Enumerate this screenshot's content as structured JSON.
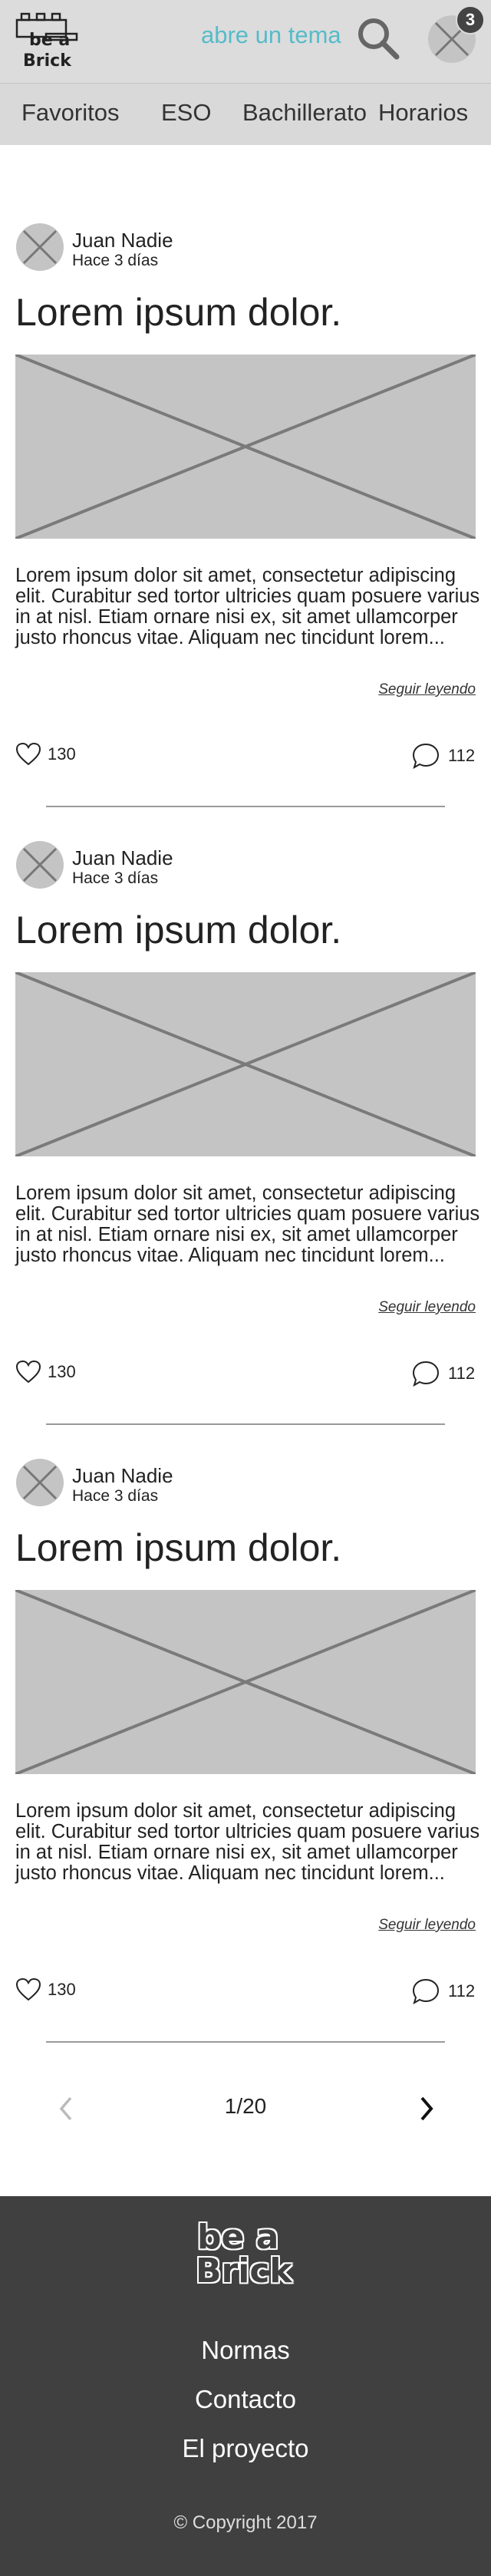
{
  "header": {
    "logo_line1": "be a",
    "logo_line2": "Brick",
    "search_placeholder": "abre un tema",
    "notification_count": "3"
  },
  "nav": {
    "items": [
      {
        "label": "Favoritos"
      },
      {
        "label": "ESO"
      },
      {
        "label": "Bachillerato"
      },
      {
        "label": "Horarios"
      }
    ]
  },
  "posts": [
    {
      "author": "Juan Nadie",
      "date": "Hace 3 días",
      "title": "Lorem ipsum dolor.",
      "excerpt": "Lorem ipsum dolor sit amet, consectetur adipiscing elit. Curabitur sed tortor ultricies quam posuere varius in at nisl. Etiam ornare nisi ex, sit amet ullamcorper justo rhoncus vitae. Aliquam nec tincidunt lorem...",
      "read_more": "Seguir leyendo",
      "likes": "130",
      "comments": "112"
    },
    {
      "author": "Juan Nadie",
      "date": "Hace 3 días",
      "title": "Lorem ipsum dolor.",
      "excerpt": "Lorem ipsum dolor sit amet, consectetur adipiscing elit. Curabitur sed tortor ultricies quam posuere varius in at nisl. Etiam ornare nisi ex, sit amet ullamcorper justo rhoncus vitae. Aliquam nec tincidunt lorem...",
      "read_more": "Seguir leyendo",
      "likes": "130",
      "comments": "112"
    },
    {
      "author": "Juan Nadie",
      "date": "Hace 3 días",
      "title": "Lorem ipsum dolor.",
      "excerpt": "Lorem ipsum dolor sit amet, consectetur adipiscing elit. Curabitur sed tortor ultricies quam posuere varius in at nisl. Etiam ornare nisi ex, sit amet ullamcorper justo rhoncus vitae. Aliquam nec tincidunt lorem...",
      "read_more": "Seguir leyendo",
      "likes": "130",
      "comments": "112"
    }
  ],
  "pagination": {
    "current": "1/20"
  },
  "footer": {
    "logo_line1": "be a",
    "logo_line2": "Brick",
    "links": [
      {
        "label": "Normas"
      },
      {
        "label": "Contacto"
      },
      {
        "label": "El proyecto"
      }
    ],
    "copyright": "© Copyright 2017"
  },
  "colors": {
    "accent": "#55bcc9",
    "header_bg": "#dcdcdc",
    "footer_bg": "#404040",
    "placeholder_gray": "#c4c4c4"
  },
  "icons": [
    "brick-logo-icon",
    "search-icon",
    "user-avatar-icon",
    "heart-icon",
    "comment-bubble-icon",
    "chevron-left-icon",
    "chevron-right-icon"
  ]
}
